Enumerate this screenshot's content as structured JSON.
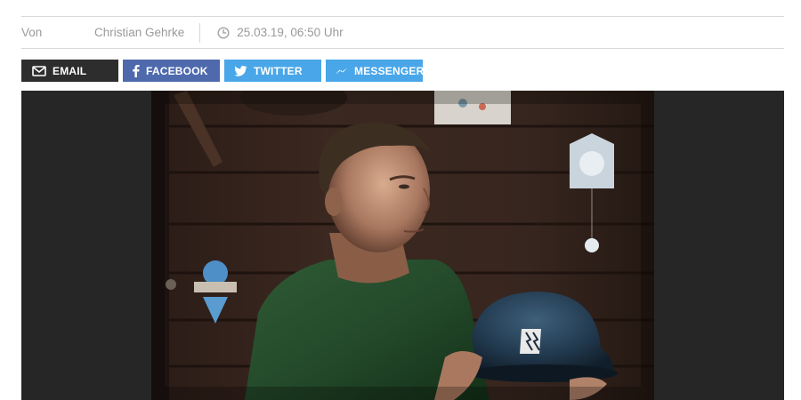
{
  "byline": {
    "prefix": "Von",
    "author": "Christian Gehrke",
    "timestamp": "25.03.19, 06:50 Uhr"
  },
  "share": {
    "email": "EMAIL",
    "facebook": "FACEBOOK",
    "twitter": "TWITTER",
    "messenger": "MESSENGER"
  },
  "colors": {
    "email": "#2d2d2d",
    "facebook": "#4e6aad",
    "twitter": "#49a6e8",
    "messenger": "#49a6e8"
  },
  "icons": {
    "email": "envelope-icon",
    "facebook": "facebook-icon",
    "twitter": "twitter-bird-icon",
    "messenger": "messenger-icon",
    "time": "clock-icon"
  }
}
